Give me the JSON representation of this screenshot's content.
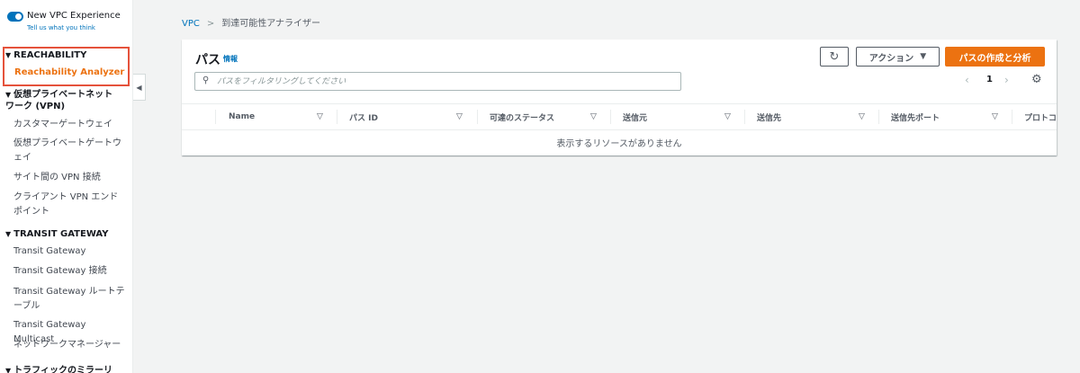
{
  "sidebar": {
    "toggle_label": "New VPC Experience",
    "feedback_link": "Tell us what you think",
    "sections": {
      "reachability": {
        "header": "REACHABILITY",
        "active_item": "Reachability Analyzer"
      },
      "vpn": {
        "header": "仮想プライベートネットワーク (VPN)",
        "items": [
          "カスタマーゲートウェイ",
          "仮想プライベートゲートウェイ",
          "サイト間の VPN 接続",
          "クライアント VPN エンドポイント"
        ]
      },
      "transit": {
        "header": "TRANSIT GATEWAY",
        "items": [
          "Transit Gateway",
          "Transit Gateway 接続",
          "Transit Gateway ルートテーブル",
          "Transit Gateway Multicast",
          "ネットワークマネージャー"
        ]
      },
      "mirroring": {
        "header": "トラフィックのミラーリ"
      }
    }
  },
  "breadcrumb": {
    "root": "VPC",
    "current": "到達可能性アナライザー"
  },
  "panel": {
    "title": "パス",
    "info": "情報",
    "actions_label": "アクション",
    "primary_label": "パスの作成と分析",
    "filter_placeholder": "パスをフィルタリングしてください",
    "page": "1",
    "columns": [
      "Name",
      "パス ID",
      "可達のステータス",
      "送信元",
      "送信先",
      "送信先ポート",
      "プロトコ"
    ],
    "empty_message": "表示するリソースがありません"
  },
  "colors": {
    "accent_link": "#0073bb",
    "primary_button": "#ec7211",
    "highlight_box": "#e5523b"
  },
  "icons": {
    "refresh": "refresh-icon",
    "caret": "caret-down-icon",
    "search": "search-icon",
    "settings": "gear-icon",
    "collapse": "chevron-left-icon"
  }
}
